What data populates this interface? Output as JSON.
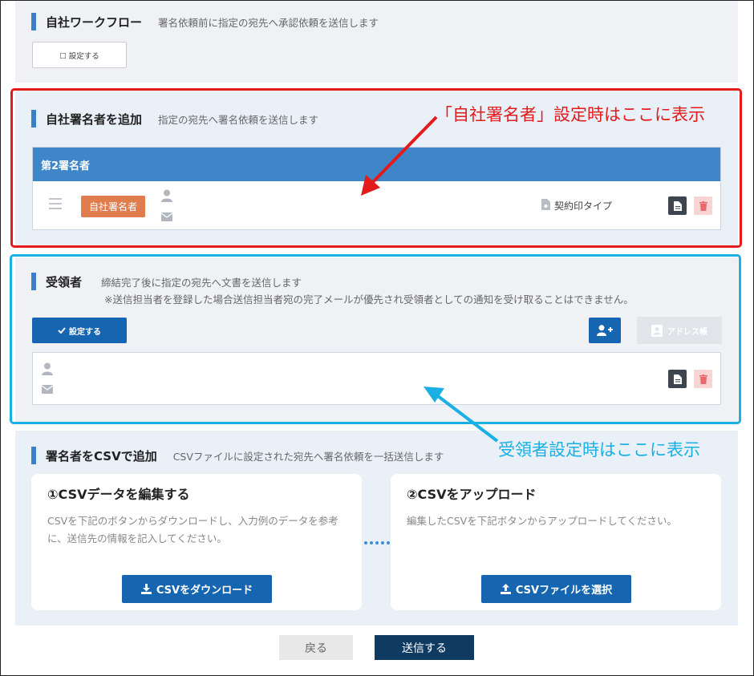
{
  "workflow": {
    "title": "自社ワークフロー",
    "desc": "署名依頼前に指定の宛先へ承認依頼を送信します",
    "button_label": "☐ 設定する"
  },
  "internal_signer": {
    "title": "自社署名者を追加",
    "desc": "指定の宛先へ署名依頼を送信します",
    "card_header": "第2署名者",
    "badge": "自社署名者",
    "stamp_type": "契約印タイプ"
  },
  "recipient": {
    "title": "受領者",
    "desc": "締結完了後に指定の宛先へ文書を送信します",
    "note": "※送信担当者を登録した場合送信担当者宛の完了メールが優先され受領者としての通知を受け取ることはできません。",
    "set_button": "設定する",
    "address_book_button": "アドレス帳"
  },
  "callouts": {
    "red": "「自社署名者」設定時はここに表示",
    "blue": "受領者設定時はここに表示"
  },
  "csv": {
    "title": "署名者をCSVで追加",
    "desc": "CSVファイルに設定された宛先へ署名依頼を一括送信します",
    "step1_title": "①CSVデータを編集する",
    "step1_text": "CSVを下記のボタンからダウンロードし、入力例のデータを参考に、送信先の情報を記入してください。",
    "step1_button": "CSVをダウンロード",
    "step2_title": "②CSVをアップロード",
    "step2_text": "編集したCSVを下記ボタンからアップロードしてください。",
    "step2_button": "CSVファイルを選択"
  },
  "footer": {
    "back": "戻る",
    "send": "送信する"
  },
  "colors": {
    "accent_blue": "#1565b0",
    "header_blue": "#3f86c8",
    "badge_orange": "#e07d4f",
    "callout_red": "#e41b1b",
    "callout_cyan": "#1ab0e4",
    "send_navy": "#0f3b63"
  },
  "icons": [
    "hamburger-icon",
    "user-icon",
    "mail-icon",
    "stamp-icon",
    "document-icon",
    "trash-icon",
    "check-icon",
    "add-user-icon",
    "address-book-icon",
    "download-icon",
    "upload-icon"
  ]
}
